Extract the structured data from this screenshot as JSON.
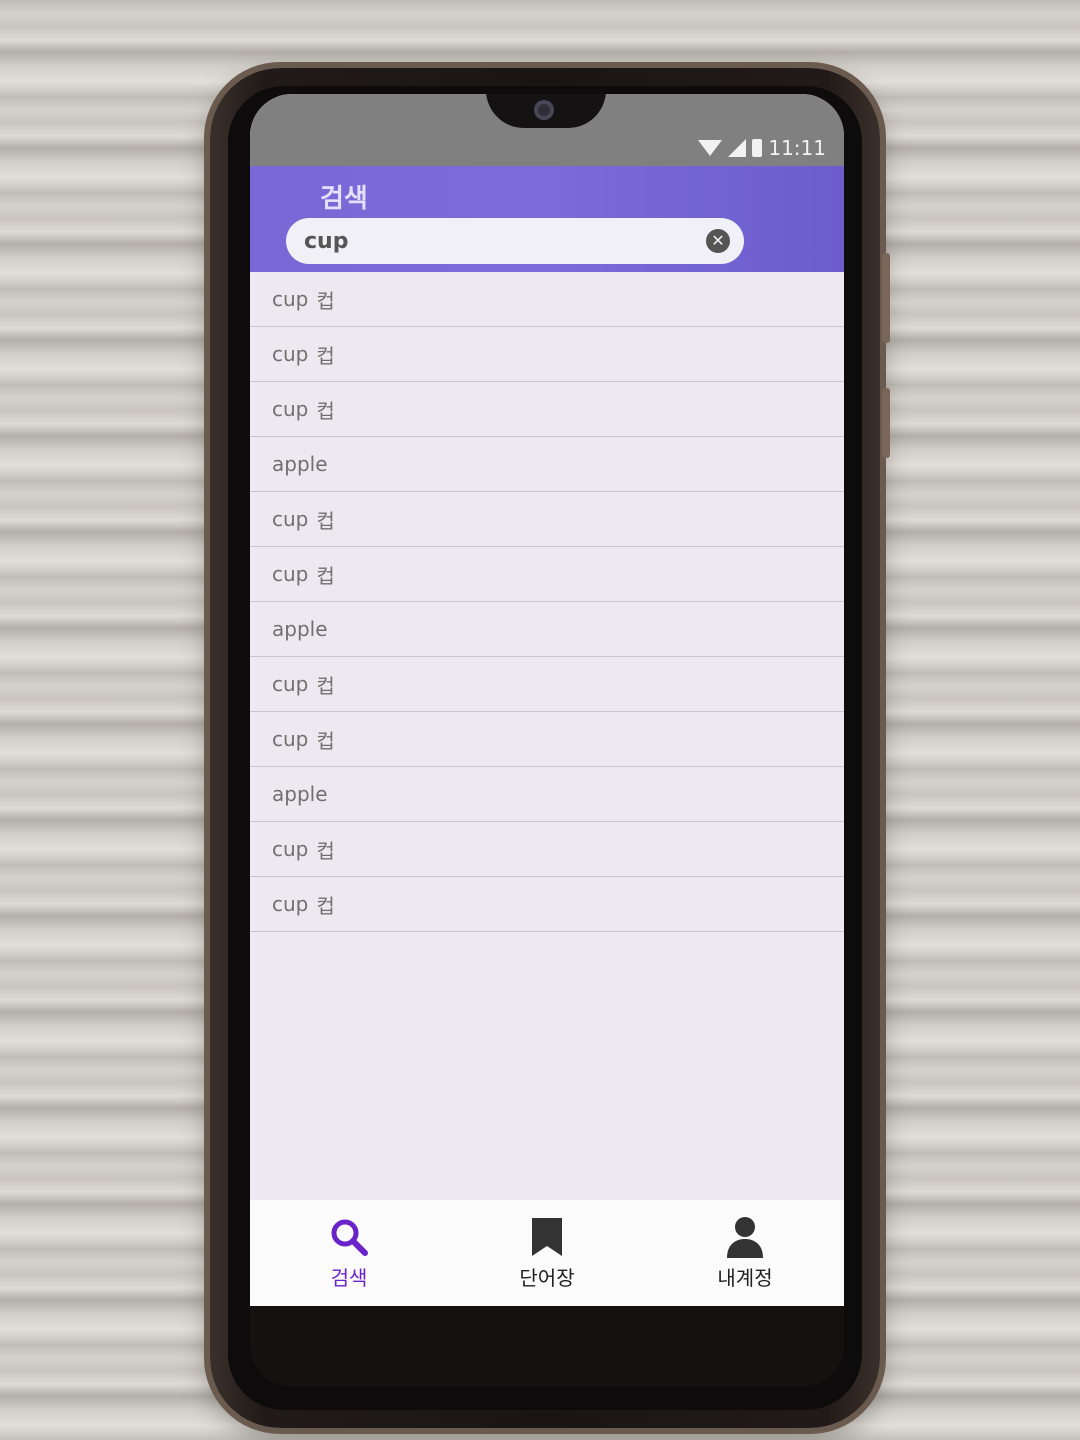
{
  "status_bar": {
    "time": "11:11"
  },
  "app_bar": {
    "title": "검색",
    "search": {
      "value": "cup"
    }
  },
  "results": [
    {
      "word": "cup",
      "meaning": "컵"
    },
    {
      "word": "cup",
      "meaning": "컵"
    },
    {
      "word": "cup",
      "meaning": "컵"
    },
    {
      "word": "apple",
      "meaning": ""
    },
    {
      "word": "cup",
      "meaning": "컵"
    },
    {
      "word": "cup",
      "meaning": "컵"
    },
    {
      "word": "apple",
      "meaning": ""
    },
    {
      "word": "cup",
      "meaning": "컵"
    },
    {
      "word": "cup",
      "meaning": "컵"
    },
    {
      "word": "apple",
      "meaning": ""
    },
    {
      "word": "cup",
      "meaning": "컵"
    },
    {
      "word": "cup",
      "meaning": "컵"
    }
  ],
  "bottom_nav": {
    "items": [
      {
        "label": "검색",
        "icon": "search-icon",
        "active": true
      },
      {
        "label": "단어장",
        "icon": "bookmark-icon",
        "active": false
      },
      {
        "label": "내계정",
        "icon": "person-icon",
        "active": false
      }
    ]
  },
  "colors": {
    "accent": "#6a22c9",
    "app_bar": "#7a68d6",
    "status_bar": "#808080"
  }
}
